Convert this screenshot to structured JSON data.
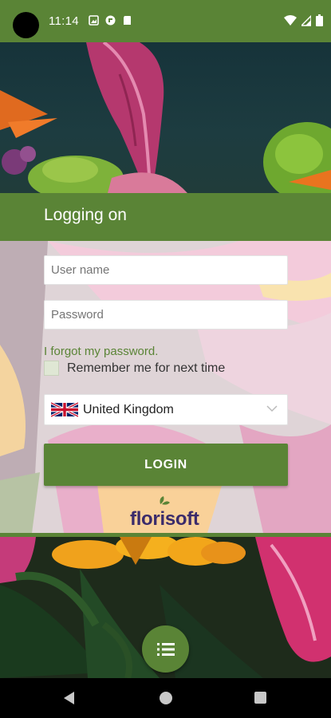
{
  "status_bar": {
    "time": "11:14",
    "left_icons": [
      "image-icon",
      "cast-icon",
      "sd-card-icon"
    ],
    "right_icons": [
      "wifi-icon",
      "signal-icon",
      "battery-icon"
    ]
  },
  "header": {
    "title": "Logging on"
  },
  "form": {
    "username_placeholder": "User name",
    "password_placeholder": "Password",
    "forgot_password": "I forgot my password.",
    "remember_me": "Remember me for next time",
    "remember_checked": false,
    "country": "United Kingdom",
    "login_label": "LOGIN"
  },
  "logo": {
    "text": "florisoft"
  },
  "fab": {
    "icon": "list-icon"
  },
  "nav": {
    "back": "back-icon",
    "home": "home-icon",
    "recents": "recents-icon"
  },
  "colors": {
    "brand_green": "#5a8436",
    "logo_purple": "#3b2b6b"
  }
}
